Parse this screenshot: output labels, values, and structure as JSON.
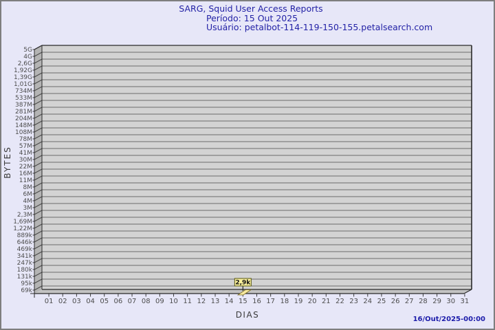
{
  "page": {
    "bg_color": "#e7e7f8",
    "border_color": "#7e7e7e"
  },
  "header": {
    "title": "SARG, Squid User Access Reports",
    "period": "Período: 15 Out 2025",
    "user": "Usuário: petalbot-114-119-150-155.petalsearch.com",
    "text_color": "#2322a6"
  },
  "footer": {
    "timestamp": "16/Out/2025-00:00"
  },
  "chart_data": {
    "type": "bar",
    "title": "SARG, Squid User Access Reports",
    "subtitle": "Período: 15 Out 2025",
    "user": "petalbot-114-119-150-155.petalsearch.com",
    "xlabel": "DIAS",
    "ylabel": "BYTES",
    "y_scale": "log",
    "grid": true,
    "y_tick_labels": [
      "5G",
      "4G",
      "2,6G",
      "1,92G",
      "1,39G",
      "1,01G",
      "734M",
      "533M",
      "387M",
      "281M",
      "204M",
      "148M",
      "108M",
      "78M",
      "57M",
      "41M",
      "30M",
      "22M",
      "16M",
      "11M",
      "8M",
      "6M",
      "4M",
      "3M",
      "2,3M",
      "1,69M",
      "1,22M",
      "889k",
      "646k",
      "469k",
      "341k",
      "247k",
      "180k",
      "131k",
      "95k",
      "69k"
    ],
    "x_tick_labels": [
      "01",
      "02",
      "03",
      "04",
      "05",
      "06",
      "07",
      "08",
      "09",
      "10",
      "11",
      "12",
      "13",
      "14",
      "15",
      "16",
      "17",
      "18",
      "19",
      "20",
      "21",
      "22",
      "23",
      "24",
      "25",
      "26",
      "27",
      "28",
      "29",
      "30",
      "31"
    ],
    "bars": [
      {
        "day": "15",
        "value_label": "2,9k",
        "approx_bytes": 2900
      }
    ],
    "colors": {
      "plot_bg": "#d3d3d3",
      "wall": "#b4b4b4",
      "floor": "#c2c2c2",
      "gridline": "#6b6b6b",
      "frame": "#2a2a2a",
      "tick_text": "#4c4c4c",
      "bar_fill": "#f6e9a0",
      "bar_border": "#7a6a1e",
      "label_box_bg": "#f8ef9c",
      "label_box_border": "#56560f",
      "label_text": "#111111"
    }
  }
}
